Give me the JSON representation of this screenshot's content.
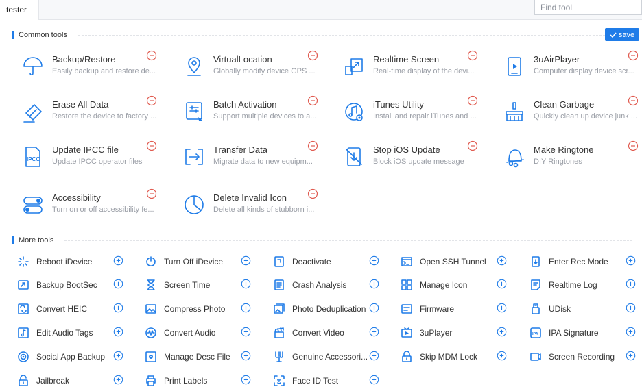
{
  "tabs": [
    {
      "label": "tester"
    }
  ],
  "search": {
    "placeholder": "Find tool"
  },
  "common": {
    "title": "Common tools",
    "save_label": "save",
    "items": [
      {
        "name": "Backup/Restore",
        "desc": "Easily backup and restore de...",
        "icon": "umbrella-icon"
      },
      {
        "name": "VirtualLocation",
        "desc": "Globally modify device GPS ...",
        "icon": "location-pin-icon"
      },
      {
        "name": "Realtime Screen",
        "desc": "Real-time display of the devi...",
        "icon": "screen-mirror-icon"
      },
      {
        "name": "3uAirPlayer",
        "desc": "Computer display device scr...",
        "icon": "phone-play-icon"
      },
      {
        "name": "Erase All Data",
        "desc": "Restore the device to factory ...",
        "icon": "eraser-icon"
      },
      {
        "name": "Batch Activation",
        "desc": "Support multiple devices to a...",
        "icon": "batch-activation-icon"
      },
      {
        "name": "iTunes Utility",
        "desc": "Install and repair iTunes and ...",
        "icon": "itunes-icon"
      },
      {
        "name": "Clean Garbage",
        "desc": "Quickly clean up device junk ...",
        "icon": "broom-icon"
      },
      {
        "name": "Update IPCC file",
        "desc": "Update IPCC operator files",
        "icon": "ipcc-file-icon"
      },
      {
        "name": "Transfer Data",
        "desc": "Migrate data to new equipm...",
        "icon": "transfer-icon"
      },
      {
        "name": "Stop iOS Update",
        "desc": "Block iOS update message",
        "icon": "stop-update-icon"
      },
      {
        "name": "Make Ringtone",
        "desc": "DIY Ringtones",
        "icon": "bell-icon"
      },
      {
        "name": "Accessibility",
        "desc": "Turn on or off accessibility fe...",
        "icon": "toggle-icon"
      },
      {
        "name": "Delete Invalid Icon",
        "desc": "Delete all kinds of stubborn i...",
        "icon": "clock-pie-icon"
      }
    ]
  },
  "more": {
    "title": "More tools",
    "items": [
      {
        "name": "Reboot iDevice",
        "icon": "reboot-icon"
      },
      {
        "name": "Turn Off iDevice",
        "icon": "power-icon"
      },
      {
        "name": "Deactivate",
        "icon": "deactivate-icon"
      },
      {
        "name": "Open SSH Tunnel",
        "icon": "terminal-icon"
      },
      {
        "name": "Enter Rec Mode",
        "icon": "recovery-icon"
      },
      {
        "name": "Backup BootSec",
        "icon": "bootsec-icon"
      },
      {
        "name": "Screen Time",
        "icon": "hourglass-icon"
      },
      {
        "name": "Crash Analysis",
        "icon": "crash-log-icon"
      },
      {
        "name": "Manage Icon",
        "icon": "grid-icon"
      },
      {
        "name": "Realtime Log",
        "icon": "log-icon"
      },
      {
        "name": "Convert HEIC",
        "icon": "convert-heic-icon"
      },
      {
        "name": "Compress Photo",
        "icon": "photo-icon"
      },
      {
        "name": "Photo Deduplication",
        "icon": "photo-dedup-icon"
      },
      {
        "name": "Firmware",
        "icon": "firmware-icon"
      },
      {
        "name": "UDisk",
        "icon": "udisk-icon"
      },
      {
        "name": "Edit Audio Tags",
        "icon": "audio-tag-icon"
      },
      {
        "name": "Convert Audio",
        "icon": "waveform-icon"
      },
      {
        "name": "Convert Video",
        "icon": "video-icon"
      },
      {
        "name": "3uPlayer",
        "icon": "tv-play-icon"
      },
      {
        "name": "IPA Signature",
        "icon": "ipa-icon"
      },
      {
        "name": "Social App Backup",
        "icon": "social-backup-icon"
      },
      {
        "name": "Manage Desc File",
        "icon": "gear-file-icon"
      },
      {
        "name": "Genuine Accessori...",
        "icon": "connector-icon"
      },
      {
        "name": "Skip MDM Lock",
        "icon": "lock-icon"
      },
      {
        "name": "Screen Recording",
        "icon": "screen-record-icon"
      },
      {
        "name": "Jailbreak",
        "icon": "unlock-icon"
      },
      {
        "name": "Print Labels",
        "icon": "printer-icon"
      },
      {
        "name": "Face ID Test",
        "icon": "face-id-icon"
      }
    ]
  },
  "colors": {
    "accent": "#1f7ce8",
    "remove": "#e05a4f",
    "add": "#1f7ce8"
  }
}
